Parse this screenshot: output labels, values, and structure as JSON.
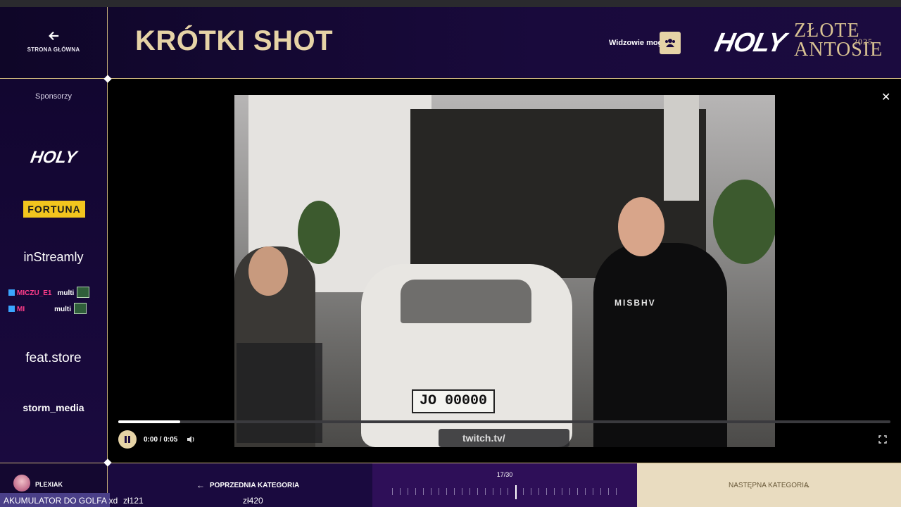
{
  "header": {
    "home_label": "STRONA GŁÓWNA",
    "title": "KRÓTKI SHOT",
    "viewers_label": "Widzowie mogą",
    "logo_holy": "HOLY",
    "award_line1": "ZŁOTE",
    "award_line2": "ANTOSIE",
    "award_year": "2025"
  },
  "sidebar": {
    "sponsors_label": "Sponsorzy",
    "sponsors": [
      "HOLY",
      "FORTUNA",
      "inStreamly",
      "feat.store",
      "storm_media"
    ],
    "chat": [
      {
        "user": "MICZU_E1",
        "msg": "multi"
      },
      {
        "user": "MI",
        "msg": "multi"
      }
    ]
  },
  "video": {
    "plate": "JO 00000",
    "shirt_text": "MISBHV",
    "watermark": "twitch.tv/",
    "time": "0:00 / 0:05",
    "progress": 0.08
  },
  "footer": {
    "user_name": "PLEXIAK",
    "prev_label": "POPRZEDNIA KATEGORIA",
    "counter": "17/30",
    "current_index": 17,
    "total": 30,
    "next_label": "NASTĘPNA KATEGORIA",
    "donation_text": "AKUMULATOR DO GOLFA xd",
    "amount1": "zł121",
    "amount2": "zł420"
  },
  "colors": {
    "gold": "#e6d3a6",
    "panel": "#1a0a3f",
    "accent_pink": "#ff3d8a"
  }
}
